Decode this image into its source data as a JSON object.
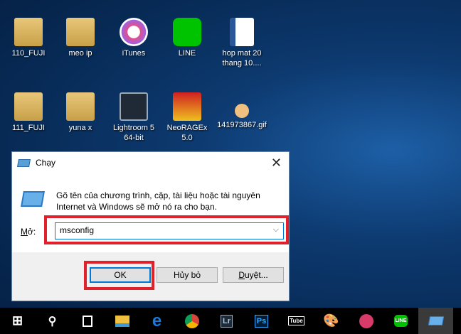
{
  "desktop_icons": [
    {
      "label": "110_FUJI",
      "icon": "folder-icon"
    },
    {
      "label": "meo ip",
      "icon": "folder-icon"
    },
    {
      "label": "iTunes",
      "icon": "itunes-icon"
    },
    {
      "label": "LINE",
      "icon": "line-icon"
    },
    {
      "label": "hop mat 20 thang 10....",
      "icon": "word-document-icon"
    },
    {
      "label": "111_FUJI",
      "icon": "folder-icon"
    },
    {
      "label": "yuna x",
      "icon": "folder-icon"
    },
    {
      "label": "Lightroom 5 64-bit",
      "icon": "lightroom-icon"
    },
    {
      "label": "NeoRAGEx 5.0",
      "icon": "neoragex-icon"
    },
    {
      "label": "141973867.gif",
      "icon": "gif-image-icon"
    }
  ],
  "dialog": {
    "title": "Chạy",
    "description": "Gõ tên của chương trình, cặp, tài liệu hoặc tài nguyên Internet và Windows sẽ mở nó ra cho bạn.",
    "open_label_underlined": "M",
    "open_label_rest": "ở:",
    "input_value": "msconfig",
    "ok": "OK",
    "cancel": "Hủy bỏ",
    "browse_underlined": "D",
    "browse_rest": "uyệt...",
    "highlight_color": "#e0202a"
  },
  "taskbar": {
    "ps": "Ps",
    "lr": "Lr",
    "line": "LINE"
  }
}
